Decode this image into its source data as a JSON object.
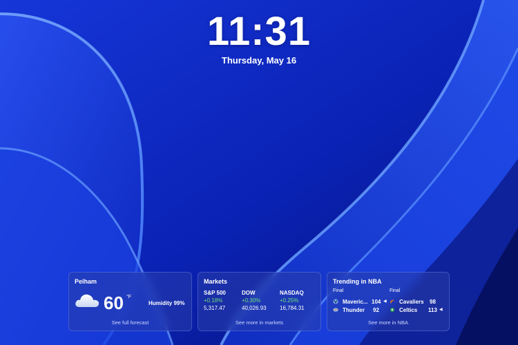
{
  "colors": {
    "background": "#0a24b8",
    "gain": "#6ee07a"
  },
  "lockscreen": {
    "time": "11:31",
    "date": "Thursday, May 16"
  },
  "weather": {
    "location": "Pelham",
    "icon": "cloud-icon",
    "temperature": "60",
    "unit": "°F",
    "humidity": "Humidity 99%",
    "link": "See full forecast"
  },
  "markets": {
    "title": "Markets",
    "items": [
      {
        "name": "S&P 500",
        "change": "+0.18%",
        "value": "5,317.47"
      },
      {
        "name": "DOW",
        "change": "+0.30%",
        "value": "40,026.93"
      },
      {
        "name": "NASDAQ",
        "change": "+0.25%",
        "value": "16,784.31"
      }
    ],
    "link": "See more in markets"
  },
  "sports": {
    "title": "Trending in NBA",
    "games": [
      {
        "status": "Final",
        "teams": [
          {
            "name": "Maveric...",
            "score": "104",
            "winner": true
          },
          {
            "name": "Thunder",
            "score": "92",
            "winner": false
          }
        ]
      },
      {
        "status": "Final",
        "teams": [
          {
            "name": "Cavaliers",
            "score": "98",
            "winner": false
          },
          {
            "name": "Celtics",
            "score": "113",
            "winner": true
          }
        ]
      }
    ],
    "link": "See more in NBA"
  }
}
